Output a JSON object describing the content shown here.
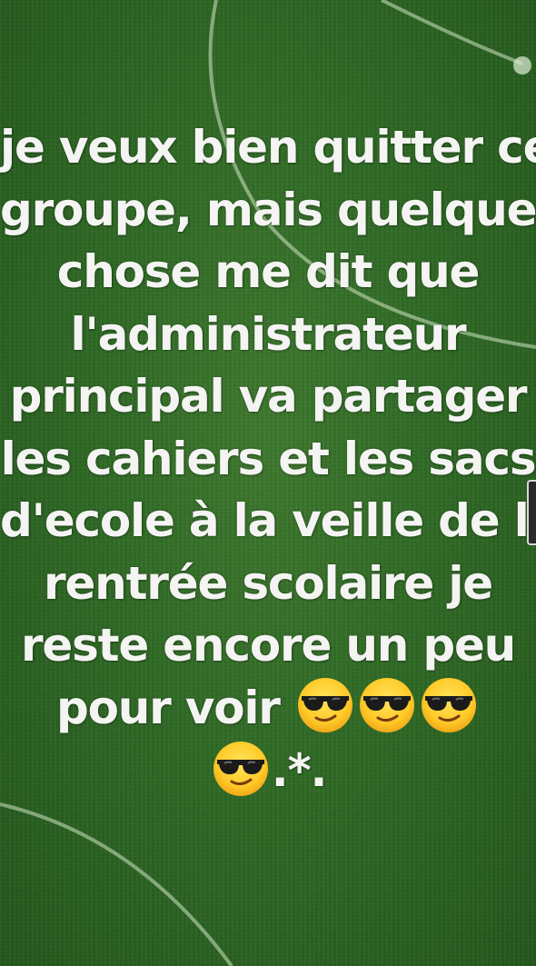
{
  "post": {
    "lines": [
      "je veux bien quitter ce",
      "groupe, mais quelque",
      "chose me dit que",
      "l'administrateur",
      "principal va partager",
      "les cahiers et les sacs",
      "d'ecole à la veille de la",
      "rentrée scolaire je",
      "reste encore un peu"
    ],
    "line10_text": "pour voir",
    "line11_suffix": ".*."
  },
  "emojis": {
    "icon": "smiling-face-with-sunglasses-icon",
    "count_line10": 3,
    "count_line11": 1
  },
  "colors": {
    "background": "#2f6a25",
    "text": "#f4f4f2",
    "field_lines": "#cfe3c4"
  }
}
